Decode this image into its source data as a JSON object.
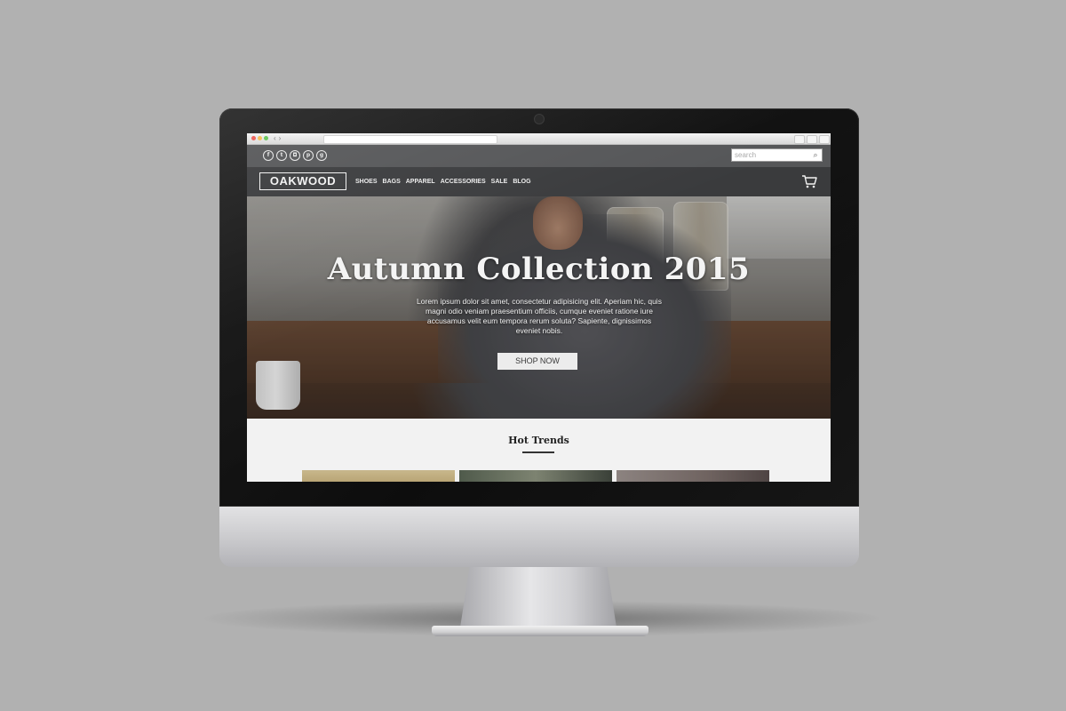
{
  "browser": {
    "back_arrow": "‹",
    "forward_arrow": "›"
  },
  "topbar": {
    "social_icons": [
      {
        "name": "facebook-icon",
        "glyph": "f"
      },
      {
        "name": "twitter-icon",
        "glyph": "t"
      },
      {
        "name": "instagram-icon",
        "glyph": "◘"
      },
      {
        "name": "pinterest-icon",
        "glyph": "p"
      },
      {
        "name": "google-plus-icon",
        "glyph": "g"
      }
    ],
    "search_placeholder": "search",
    "search_icon": "⌕"
  },
  "navbar": {
    "logo": "OAKWOOD",
    "menu": [
      "SHOES",
      "BAGS",
      "APPAREL",
      "ACCESSORIES",
      "SALE",
      "BLOG"
    ],
    "cart_icon": "cart-icon"
  },
  "hero": {
    "title": "Autumn Collection 2015",
    "text": "Lorem ipsum dolor sit amet, consectetur adipisicing elit. Aperiam hic, quis magni odio veniam praesentium officiis, cumque eveniet ratione iure accusamus velit eum tempora rerum soluta? Sapiente, dignissimos eveniet nobis.",
    "button_label": "SHOP NOW"
  },
  "trends": {
    "title": "Hot Trends"
  },
  "colors": {
    "background": "#b1b1b1",
    "topbar": "#555658",
    "navbar": "#3a3b3d",
    "trends_bg": "#f2f2f2"
  }
}
